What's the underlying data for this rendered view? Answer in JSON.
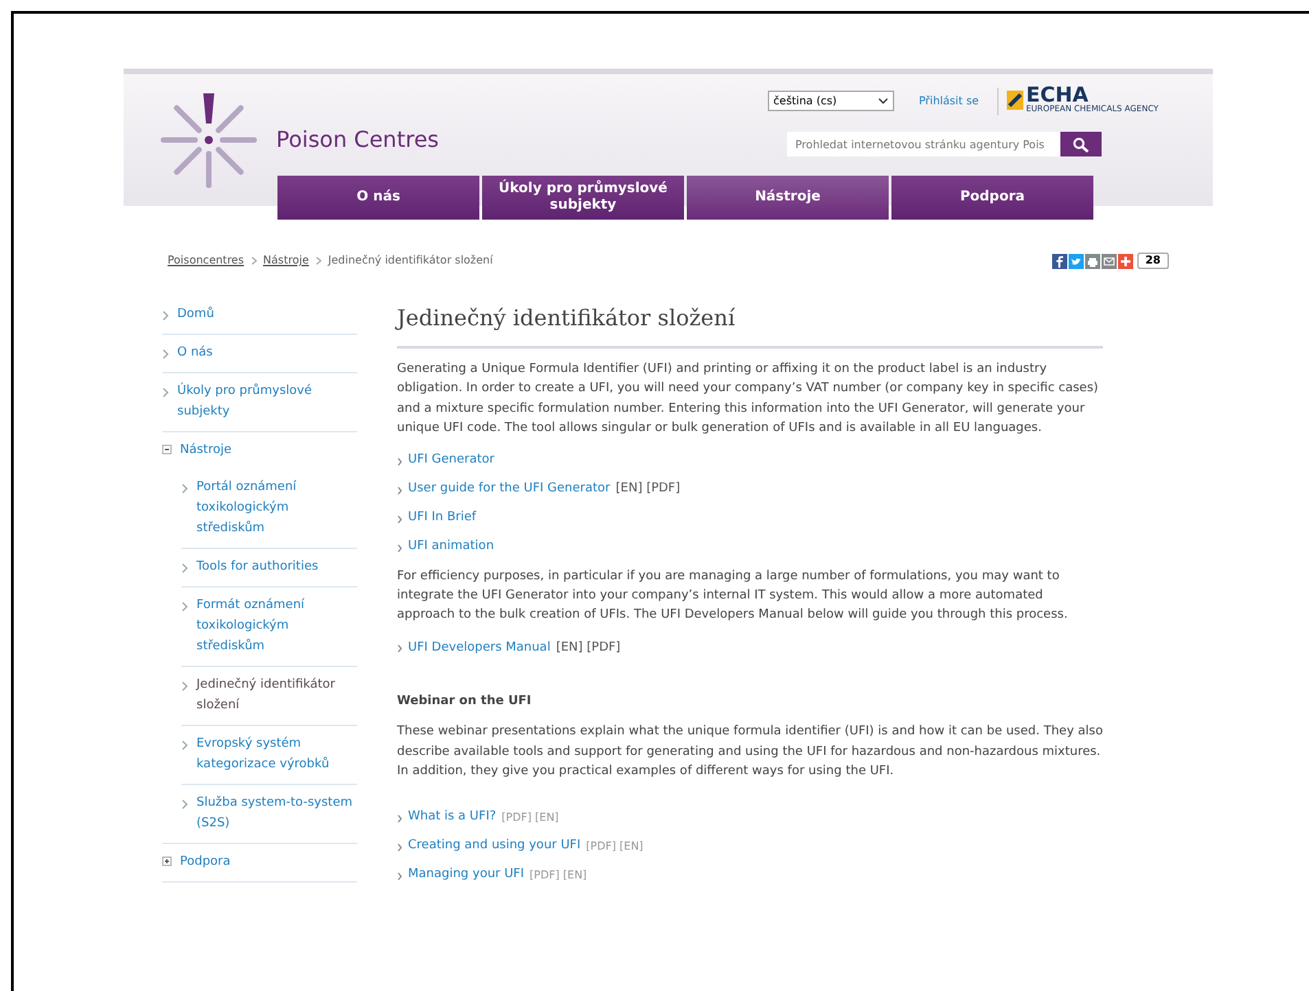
{
  "header": {
    "site_title": "Poison Centres",
    "language": {
      "value": "čeština (cs)"
    },
    "login": "Přihlásit se",
    "logo": {
      "name": "ECHA",
      "tagline": "EUROPEAN CHEMICALS AGENCY"
    },
    "search": {
      "placeholder": "Prohledat internetovou stránku agentury Pois"
    }
  },
  "nav": [
    {
      "label": "O nás",
      "selected": false
    },
    {
      "label": "Úkoly pro průmyslové subjekty",
      "selected": false
    },
    {
      "label": "Nástroje",
      "selected": true
    },
    {
      "label": "Podpora",
      "selected": false
    }
  ],
  "breadcrumb": [
    {
      "label": "Poisoncentres",
      "kind": "link"
    },
    {
      "label": "Nástroje",
      "kind": "link"
    },
    {
      "label": "Jedinečný identifikátor složení",
      "kind": "current"
    }
  ],
  "share": {
    "count": "28"
  },
  "sidebar": [
    {
      "label": "Domů",
      "kind": "link"
    },
    {
      "label": "O nás",
      "kind": "link"
    },
    {
      "label": "Úkoly pro průmyslové subjekty",
      "kind": "link"
    },
    {
      "label": "Nástroje",
      "kind": "toggle",
      "expanded": true,
      "children": [
        {
          "label": "Portál oznámení toxikologickým střediskům",
          "selected": false
        },
        {
          "label": "Tools for authorities",
          "selected": false
        },
        {
          "label": "Formát oznámení toxikologickým střediskům",
          "selected": false
        },
        {
          "label": "Jedinečný identifikátor složení",
          "selected": true
        },
        {
          "label": "Evropský systém kategorizace výrobků",
          "selected": false
        },
        {
          "label": "Služba system-to-system (S2S)",
          "selected": false
        }
      ]
    },
    {
      "label": "Podpora",
      "kind": "toggle",
      "expanded": false
    }
  ],
  "main": {
    "title": "Jedinečný identifikátor složení",
    "blocks": [
      {
        "kind": "paragraph",
        "text": "Generating a Unique Formula Identifier (UFI) and printing or affixing it on the product label is an industry obligation. In order to create a UFI, you will need your company’s VAT number (or company key in specific cases) and a mixture specific formulation number. Entering this information into the UFI Generator, will generate your unique UFI code. The tool allows singular or bulk generation of UFIs and is available in all EU languages."
      },
      {
        "kind": "link",
        "label": "UFI Generator"
      },
      {
        "kind": "link",
        "label": "User guide for the UFI Generator",
        "suffix": "[EN] [PDF]"
      },
      {
        "kind": "link",
        "label": "UFI In Brief"
      },
      {
        "kind": "link",
        "label": "UFI animation"
      },
      {
        "kind": "paragraph",
        "text": "For efficiency purposes, in particular if you are managing a large number of formulations, you may want to integrate the UFI Generator into your company’s internal IT system. This would allow a more automated approach to the bulk creation of UFIs. The UFI Developers Manual below will guide you through this process."
      },
      {
        "kind": "link",
        "label": "UFI Developers Manual",
        "suffix": "[EN] [PDF]"
      },
      {
        "kind": "heading",
        "text": "Webinar on the UFI"
      },
      {
        "kind": "paragraph",
        "text": "These webinar presentations explain what the unique formula identifier (UFI) is and how it can be used. They also describe available tools and support for generating and using the UFI for hazardous and non-hazardous mixtures. In addition, they give you practical examples of different ways for using the UFI."
      },
      {
        "kind": "small-link",
        "label": "What is a UFI?",
        "suffix": "[PDF] [EN]"
      },
      {
        "kind": "small-link",
        "label": "Creating and using your UFI",
        "suffix": "[PDF] [EN]"
      },
      {
        "kind": "small-link",
        "label": "Managing your UFI",
        "suffix": "[PDF] [EN]"
      }
    ]
  }
}
